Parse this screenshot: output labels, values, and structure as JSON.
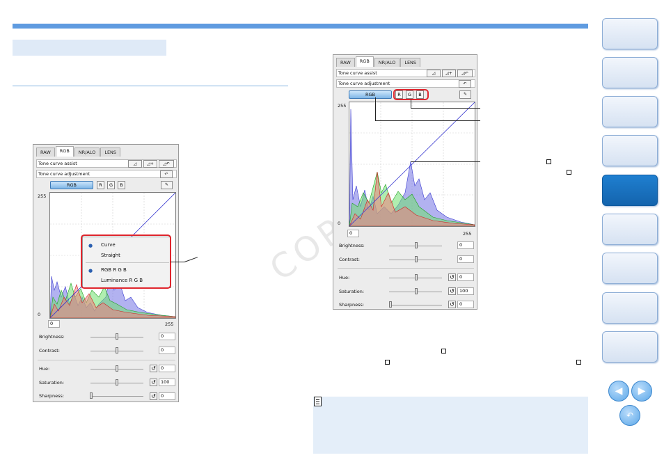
{
  "watermark": "COPY",
  "left_panel": {
    "tabs": [
      "RAW",
      "RGB",
      "NR/ALO",
      "LENS"
    ],
    "tone_curve_assist": "Tone curve assist",
    "tone_curve_adjustment": "Tone curve adjustment",
    "channel_buttons": {
      "rgb": "RGB",
      "r": "R",
      "g": "G",
      "b": "B"
    },
    "axis": {
      "top": "255",
      "left_zero": "0",
      "bottom_left": "0",
      "bottom_right": "255"
    },
    "popup": {
      "curve": "Curve",
      "straight": "Straight",
      "rgb_rgb": "RGB R G B",
      "luminance": "Luminance R G B"
    },
    "sliders": [
      {
        "label": "Brightness:",
        "value": "0",
        "position": 0.5
      },
      {
        "label": "Contrast:",
        "value": "0",
        "position": 0.5
      },
      {
        "label": "Hue:",
        "value": "0",
        "position": 0.5
      },
      {
        "label": "Saturation:",
        "value": "100",
        "position": 0.5
      },
      {
        "label": "Sharpness:",
        "value": "0",
        "position": 0.0
      }
    ]
  },
  "right_panel": {
    "tabs": [
      "RAW",
      "RGB",
      "NR/ALO",
      "LENS"
    ],
    "tone_curve_assist": "Tone curve assist",
    "tone_curve_adjustment": "Tone curve adjustment",
    "channel_buttons": {
      "rgb": "RGB",
      "r": "R",
      "g": "G",
      "b": "B"
    },
    "axis": {
      "top": "255",
      "left_zero": "0",
      "bottom_left": "0",
      "bottom_right": "255"
    },
    "sliders": [
      {
        "label": "Brightness:",
        "value": "0",
        "position": 0.5
      },
      {
        "label": "Contrast:",
        "value": "0",
        "position": 0.5
      },
      {
        "label": "Hue:",
        "value": "0",
        "position": 0.5
      },
      {
        "label": "Saturation:",
        "value": "100",
        "position": 0.5
      },
      {
        "label": "Sharpness:",
        "value": "0",
        "position": 0.0
      }
    ]
  },
  "sidebar": {
    "items": 9,
    "active_index": 4
  },
  "icons": {
    "prev": "arrow-left-icon",
    "next": "arrow-right-icon",
    "back": "return-icon",
    "note": "memo-icon"
  },
  "colors": {
    "accent": "#5f9be0",
    "active_nav": "#1670bf",
    "highlight": "#e0252d"
  }
}
